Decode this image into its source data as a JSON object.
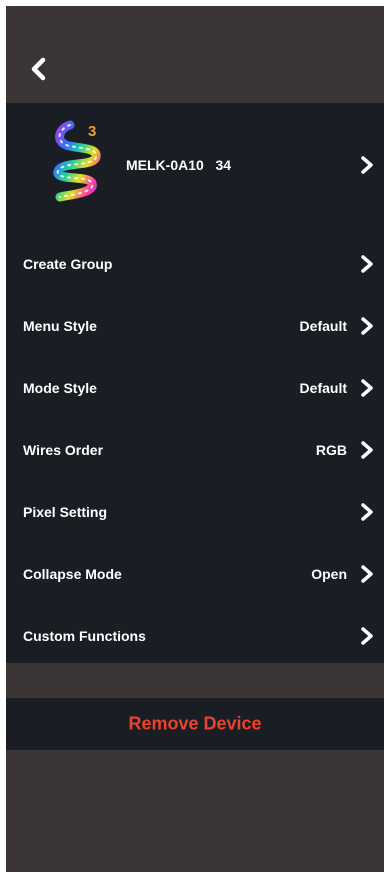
{
  "header": {
    "back_icon": "chevron-left-icon"
  },
  "device": {
    "logo_icon": "light-strip-logo-icon",
    "badge_number": "3",
    "name": "MELK-0A10   34",
    "chevron_icon": "chevron-right-icon"
  },
  "settings": [
    {
      "label": "Create Group",
      "value": ""
    },
    {
      "label": "Menu Style",
      "value": "Default"
    },
    {
      "label": "Mode Style",
      "value": "Default"
    },
    {
      "label": "Wires Order",
      "value": "RGB"
    },
    {
      "label": "Pixel Setting",
      "value": ""
    },
    {
      "label": "Collapse Mode",
      "value": "Open"
    },
    {
      "label": "Custom Functions",
      "value": ""
    }
  ],
  "remove": {
    "label": "Remove Device"
  },
  "colors": {
    "background": "#3b3535",
    "panel": "#1b1d24",
    "text": "#ffffff",
    "danger": "#e8432f",
    "badge": "#f0a020"
  }
}
